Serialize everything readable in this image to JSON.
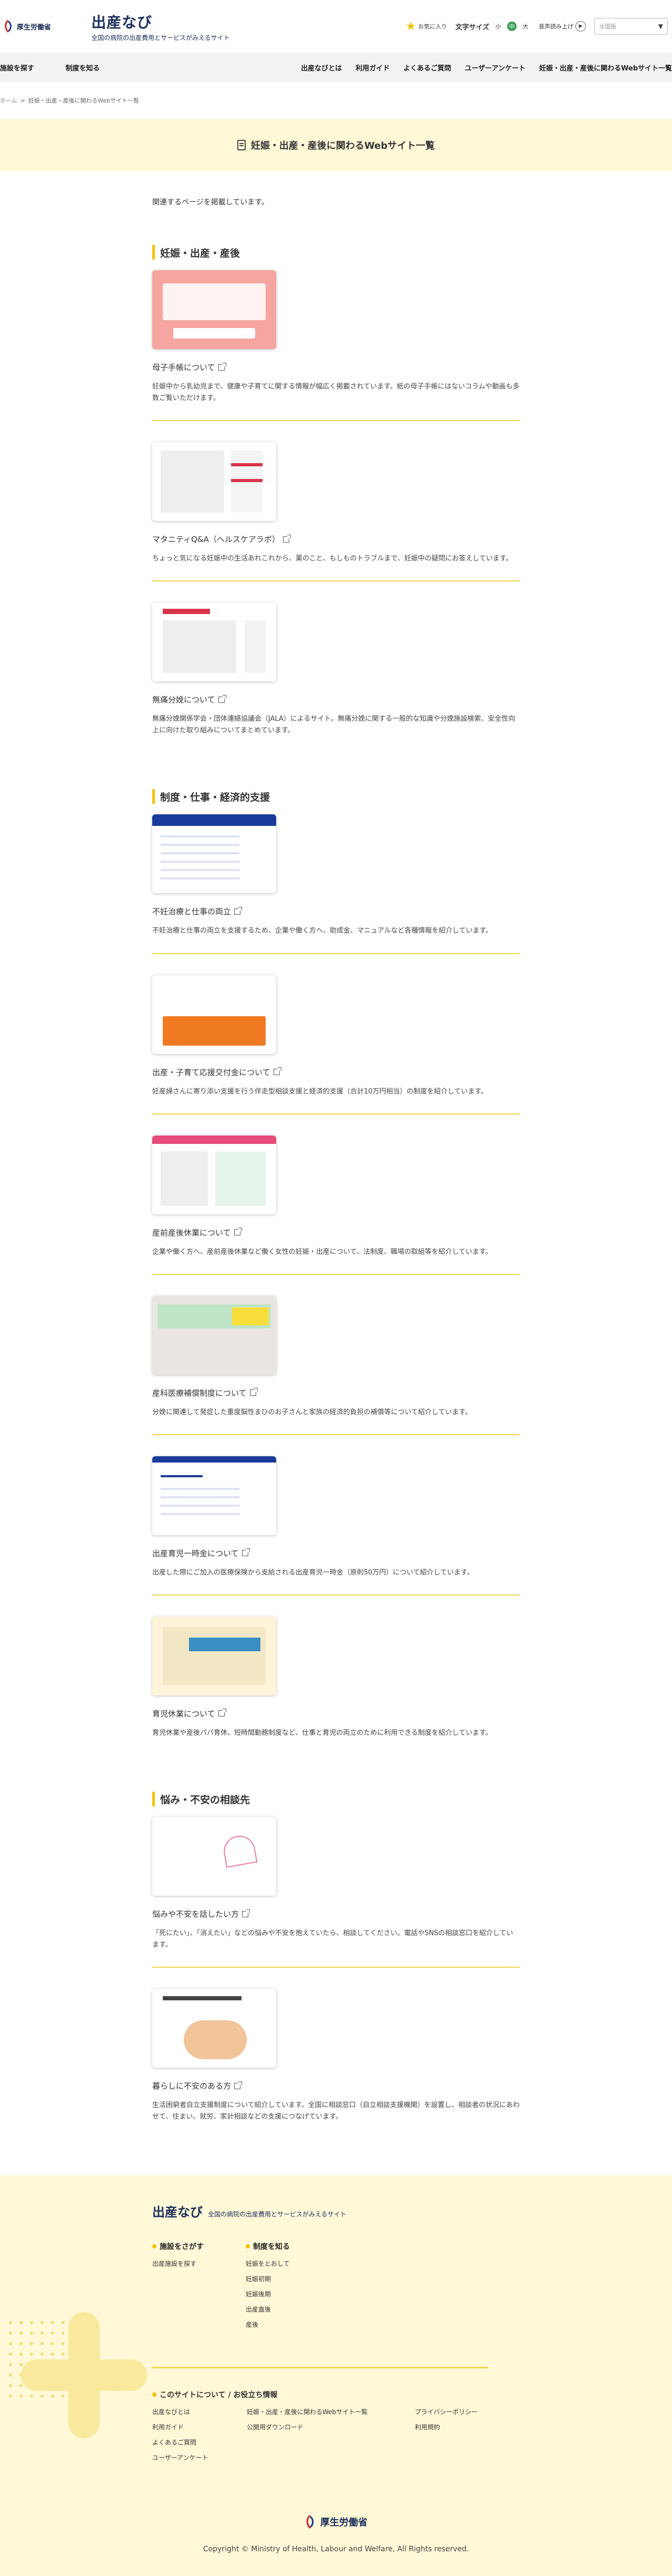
{
  "header": {
    "logo_text": "厚生労働省",
    "site_title": "出産なび",
    "site_subtitle": "全国の病院の出産費用とサービスがみえるサイト",
    "favorite_label": "お気に入り",
    "fontsize_label": "文字サイズ",
    "fontsize_small": "小",
    "fontsize_mid": "中",
    "fontsize_large": "大",
    "voice_label": "音声読み上げ",
    "search_placeholder": "全国版"
  },
  "nav": {
    "left": [
      "施設を探す",
      "制度を知る"
    ],
    "right": [
      "出産なびとは",
      "利用ガイド",
      "よくあるご質問",
      "ユーザーアンケート",
      "妊娠・出産・産後に関わるWebサイト一覧"
    ]
  },
  "breadcrumb": {
    "home": "ホーム",
    "sep": ">",
    "current": "妊娠・出産・産後に関わるWebサイト一覧"
  },
  "page_title": "妊娠・出産・産後に関わるWebサイト一覧",
  "lead": "関連するページを掲載しています。",
  "sections": [
    {
      "title": "妊娠・出産・産後",
      "items": [
        {
          "title": "母子手帳について",
          "desc": "妊娠中から乳幼児まで、健康や子育てに関する情報が幅広く掲載されています。紙の母子手帳にはないコラムや動画も多数ご覧いただけます。"
        },
        {
          "title": "マタニティQ&A（ヘルスケアラボ）",
          "desc": "ちょっと気になる妊娠中の生活あれこれから、薬のこと、もしものトラブルまで、妊娠中の疑問にお答えしています。"
        },
        {
          "title": "無痛分娩について",
          "desc": "無痛分娩関係学会・団体連絡協議会（JALA）によるサイト。無痛分娩に関する一般的な知識や分娩施設検索、安全性向上に向けた取り組みについてまとめています。"
        }
      ]
    },
    {
      "title": "制度・仕事・経済的支援",
      "items": [
        {
          "title": "不妊治療と仕事の両立",
          "desc": "不妊治療と仕事の両立を支援するため、企業や働く方へ、助成金、マニュアルなど各種情報を紹介しています。"
        },
        {
          "title": "出産・子育て応援交付金について",
          "desc": "妊産婦さんに寄り添い支援を行う伴走型相談支援と経済的支援（合計10万円相当）の制度を紹介しています。"
        },
        {
          "title": "産前産後休業について",
          "desc": "企業や働く方へ、産前産後休業など働く女性の妊娠・出産について、法制度、職場の取組等を紹介しています。"
        },
        {
          "title": "産科医療補償制度について",
          "desc": "分娩に関連して発症した重度脳性まひのお子さんと家族の経済的負担の補償等について紹介しています。"
        },
        {
          "title": "出産育児一時金について",
          "desc": "出産した際にご加入の医療保険から支給される出産育児一時金（原則50万円）について紹介しています。"
        },
        {
          "title": "育児休業について",
          "desc": "育児休業や産後パパ育休、短時間勤務制度など、仕事と育児の両立のために利用できる制度を紹介しています。"
        }
      ]
    },
    {
      "title": "悩み・不安の相談先",
      "items": [
        {
          "title": "悩みや不安を話したい方",
          "desc": "「死にたい」、「消えたい」などの悩みや不安を抱えていたら、相談してください。電話やSNSの相談窓口を紹介しています。"
        },
        {
          "title": "暮らしに不安のある方",
          "desc": "生活困窮者自立支援制度について紹介しています。全国に相談窓口（自立相談支援機関）を設置し、相談者の状況にあわせて、住まい、就労、家計相談などの支援につなげています。"
        }
      ]
    }
  ],
  "footer": {
    "site_title": "出産なび",
    "site_subtitle": "全国の病院の出産費用とサービスがみえるサイト",
    "col1_title": "施設をさがす",
    "col1_links": [
      "出産施設を探す"
    ],
    "col2_title": "制度を知る",
    "col2_links": [
      "妊娠をとおして",
      "妊娠初期",
      "妊娠後期",
      "出産直後",
      "産後"
    ],
    "about_title": "このサイトについて / お役立ち情報",
    "about_links": [
      "出産なびとは",
      "妊娠・出産・産後に関わるWebサイト一覧",
      "プライバシーポリシー",
      "利用ガイド",
      "公開用ダウンロード",
      "利用規約",
      "よくあるご質問",
      "",
      "",
      "ユーザーアンケート",
      "",
      ""
    ],
    "logo_text": "厚生労働省",
    "copyright": "Copyright © Ministry of Health, Labour and Welfare, All Rights reserved."
  },
  "colors": {
    "accent_yellow": "#f2c200",
    "navy": "#1a2d5a",
    "pale_yellow": "#fff9d8"
  }
}
